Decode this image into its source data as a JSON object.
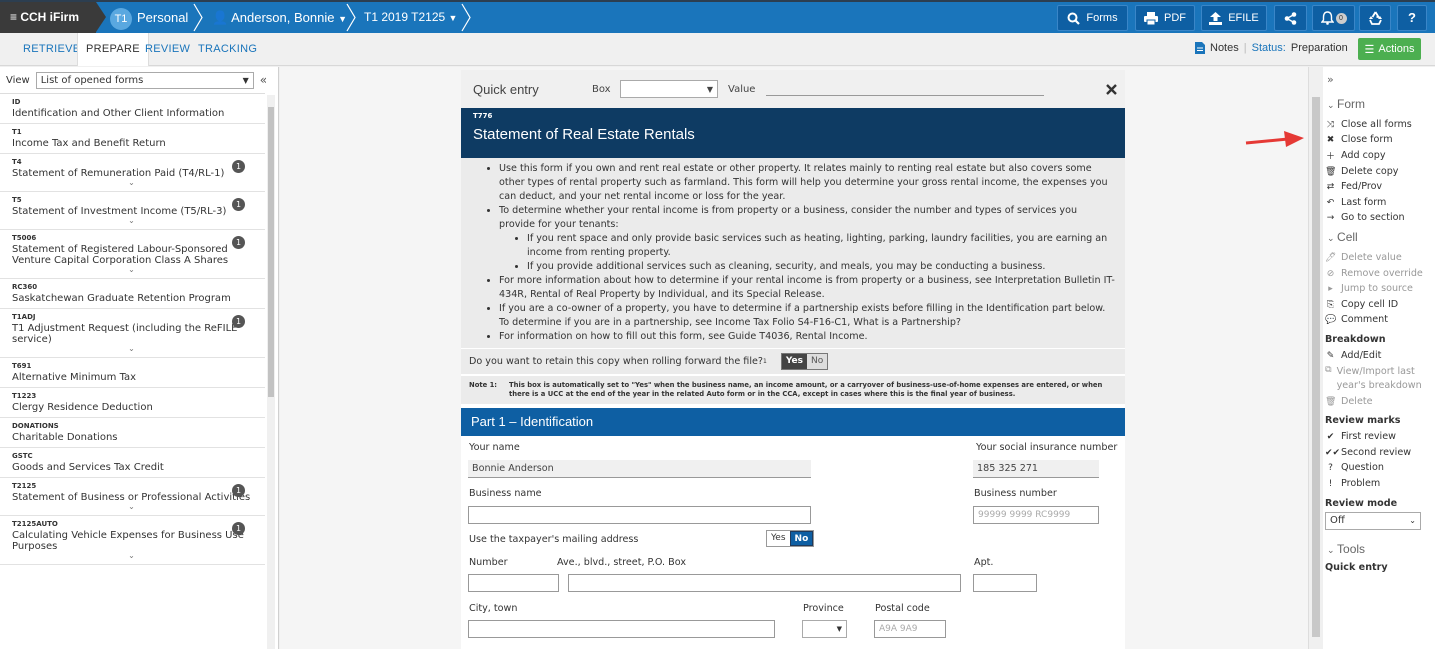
{
  "app": {
    "brand": "CCH iFirm",
    "module_badge": "T1",
    "module": "Personal",
    "client": "Anderson, Bonnie",
    "return": "T1 2019 T2125"
  },
  "toolbar": {
    "forms": "Forms",
    "pdf": "PDF",
    "efile": "EFILE",
    "notif_count": "0",
    "help": "?"
  },
  "subtabs": [
    "RETRIEVE",
    "PREPARE",
    "REVIEW",
    "TRACKING"
  ],
  "status": {
    "notes": "Notes",
    "status_label": "Status:",
    "status_value": "Preparation",
    "actions": "Actions"
  },
  "left": {
    "view_label": "View",
    "view_value": "List of opened forms",
    "collapse": "«",
    "forms": [
      {
        "code": "ID",
        "name": "Identification and Other Client Information",
        "badge": "",
        "chev": false
      },
      {
        "code": "T1",
        "name": "Income Tax and Benefit Return",
        "badge": "",
        "chev": false
      },
      {
        "code": "T4",
        "name": "Statement of Remuneration Paid (T4/RL-1)",
        "badge": "1",
        "chev": true
      },
      {
        "code": "T5",
        "name": "Statement of Investment Income (T5/RL-3)",
        "badge": "1",
        "chev": true
      },
      {
        "code": "T5006",
        "name": "Statement of Registered Labour-Sponsored Venture Capital Corporation Class A Shares",
        "badge": "1",
        "chev": true
      },
      {
        "code": "RC360",
        "name": "Saskatchewan Graduate Retention Program",
        "badge": "",
        "chev": false
      },
      {
        "code": "T1ADJ",
        "name": "T1 Adjustment Request (including the ReFILE service)",
        "badge": "1",
        "chev": true
      },
      {
        "code": "T691",
        "name": "Alternative Minimum Tax",
        "badge": "",
        "chev": false
      },
      {
        "code": "T1223",
        "name": "Clergy Residence Deduction",
        "badge": "",
        "chev": false
      },
      {
        "code": "DONATIONS",
        "name": "Charitable Donations",
        "badge": "",
        "chev": false
      },
      {
        "code": "GSTC",
        "name": "Goods and Services Tax Credit",
        "badge": "",
        "chev": false
      },
      {
        "code": "T2125",
        "name": "Statement of Business or Professional Activities",
        "badge": "1",
        "chev": true
      },
      {
        "code": "T2125AUTO",
        "name": "Calculating Vehicle Expenses for Business Use Purposes",
        "badge": "1",
        "chev": true
      }
    ]
  },
  "quick": {
    "title": "Quick entry",
    "box_label": "Box",
    "value_label": "Value"
  },
  "form": {
    "code": "T776",
    "title": "Statement of Real Estate Rentals",
    "b1": "Use this form if you own and rent real estate or other property. It relates mainly to renting real estate but also covers some other types of rental property such as farmland. This form will help you determine your gross rental income, the expenses you can deduct, and your net rental income or loss for the year.",
    "b2": "To determine whether your rental income is from property or a business, consider the number and types of services you provide for your tenants:",
    "b2a": "If you rent space and only provide basic services such as heating, lighting, parking, laundry facilities, you are earning an income from renting property.",
    "b2b": "If you provide additional services such as cleaning, security, and meals, you may be conducting a business.",
    "b3": "For more information about how to determine if your rental income is from property or a business, see Interpretation Bulletin IT-434R, Rental of Real Property by Individual, and its Special Release.",
    "b4": "If you are a co-owner of a property, you have to determine if a partnership exists before filling in the Identification part below. To determine if you are in a partnership, see Income Tax Folio S4-F16-C1, What is a Partnership?",
    "b5": "For information on how to fill out this form, see Guide T4036, Rental Income.",
    "retain_q": "Do you want to retain this copy when rolling forward the file?",
    "retain_sup": "1",
    "yes": "Yes",
    "no": "No",
    "note_label": "Note 1:",
    "note_text": "This box is automatically set to \"Yes\" when the business name, an income amount, or a carryover of business-use-of-home expenses are entered, or when there is a UCC at the end of the year in the related Auto form or in the CCA, except in cases where this is the final year of business.",
    "part1": "Part 1 – Identification",
    "your_name": "Your name",
    "name_value": "Bonnie Anderson",
    "sin_label": "Your social insurance number",
    "sin_value": "185 325 271",
    "bus_name": "Business name",
    "bus_num": "Business number",
    "bus_num_ph": "99999 9999 RC9999",
    "mailing": "Use the taxpayer's mailing address",
    "number": "Number",
    "street": "Ave., blvd., street, P.O. Box",
    "apt": "Apt.",
    "city": "City, town",
    "province": "Province",
    "postal": "Postal code",
    "postal_ph": "A9A 9A9"
  },
  "right": {
    "form_sec": "Form",
    "form_items": [
      "Close all forms",
      "Close form",
      "Add copy",
      "Delete copy",
      "Fed/Prov",
      "Last form",
      "Go to section"
    ],
    "cell_sec": "Cell",
    "cell_items": [
      "Delete value",
      "Remove override",
      "Jump to source",
      "Copy cell ID",
      "Comment"
    ],
    "breakdown": "Breakdown",
    "breakdown_items": [
      "Add/Edit",
      "View/Import last year's breakdown",
      "Delete"
    ],
    "review_marks": "Review marks",
    "review_items": [
      "First review",
      "Second review",
      "Question",
      "Problem"
    ],
    "review_mode": "Review mode",
    "review_mode_value": "Off",
    "tools_sec": "Tools",
    "quick_entry": "Quick entry"
  },
  "colors": {
    "topbar": "#1a75bb",
    "form_header": "#0e3b63",
    "part_header": "#0e5fa3",
    "actions_green": "#4caf50",
    "arrow_red": "#e53935"
  }
}
